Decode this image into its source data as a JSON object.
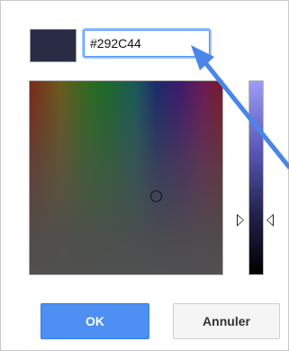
{
  "dialog": {
    "current_color": "#292C44",
    "hex_input": {
      "value": "#292C44",
      "placeholder": ""
    },
    "hue_strip_colors": [
      "#7a2a1a",
      "#6b5a1e",
      "#2f6b1f",
      "#1a5a5a",
      "#1a2a6b",
      "#3d1a6b",
      "#6b1a55"
    ],
    "value_slider_colors": [
      "#9c9cf6",
      "#000000"
    ],
    "buttons": {
      "ok_label": "OK",
      "cancel_label": "Annuler"
    }
  },
  "annotation": {
    "pointer_color": "#4a86e8"
  },
  "colors": {
    "accent": "#4d8ff3",
    "focus_ring": "#4d90fe",
    "cancel_bg": "#f5f5f5"
  }
}
